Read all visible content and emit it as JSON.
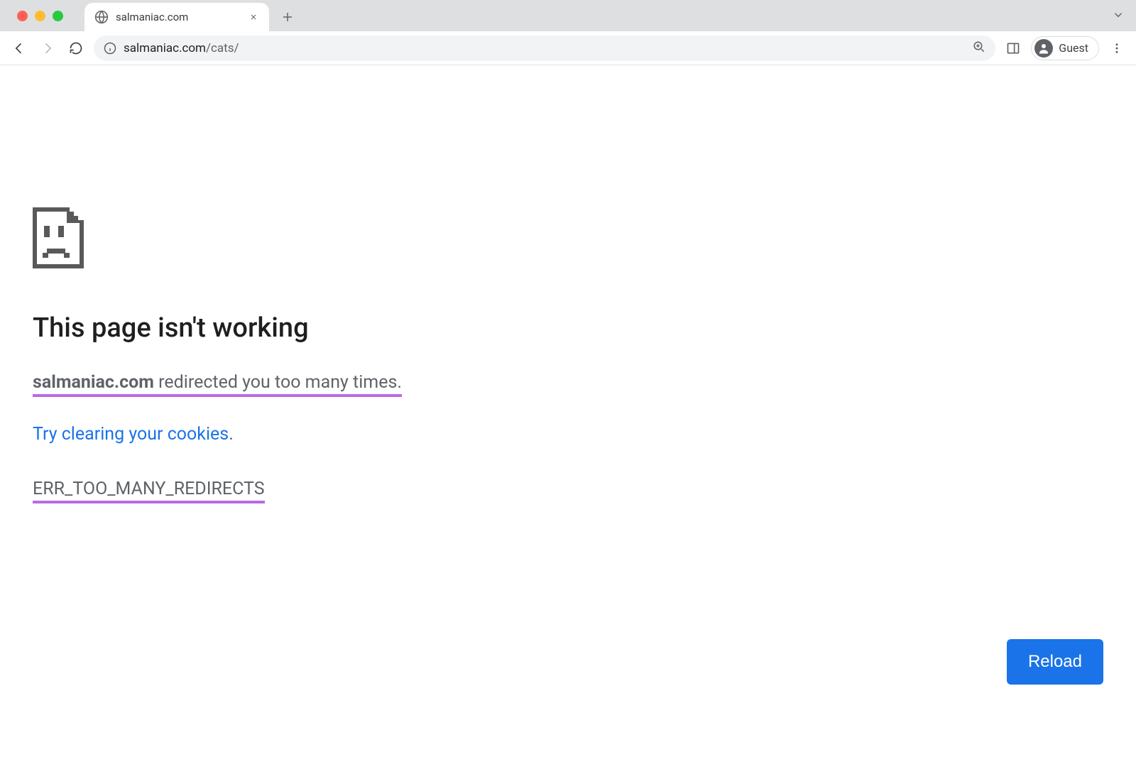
{
  "window": {
    "tab_title": "salmaniac.com",
    "url_host": "salmaniac.com",
    "url_path": "/cats/"
  },
  "profile": {
    "label": "Guest"
  },
  "error": {
    "heading": "This page isn't working",
    "host": "salmaniac.com",
    "redirect_msg": " redirected you too many times. ",
    "cookies_link": "Try clearing your cookies",
    "cookies_period": ".",
    "code": "ERR_TOO_MANY_REDIRECTS",
    "reload_label": "Reload"
  }
}
